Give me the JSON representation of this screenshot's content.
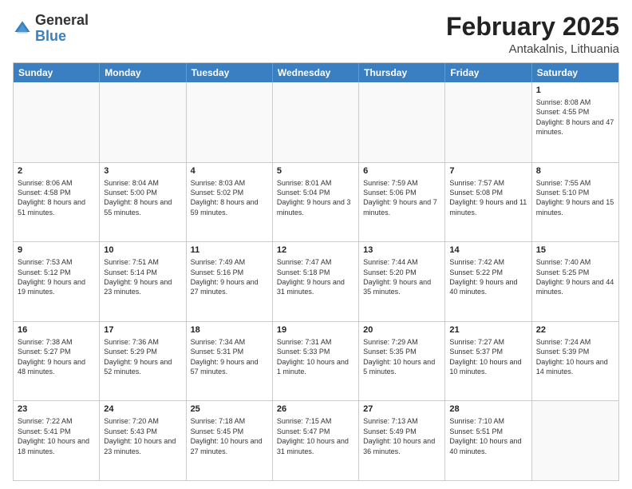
{
  "header": {
    "logo": {
      "general": "General",
      "blue": "Blue"
    },
    "title": "February 2025",
    "location": "Antakalnis, Lithuania"
  },
  "days_of_week": [
    "Sunday",
    "Monday",
    "Tuesday",
    "Wednesday",
    "Thursday",
    "Friday",
    "Saturday"
  ],
  "weeks": [
    [
      {
        "day": "",
        "text": ""
      },
      {
        "day": "",
        "text": ""
      },
      {
        "day": "",
        "text": ""
      },
      {
        "day": "",
        "text": ""
      },
      {
        "day": "",
        "text": ""
      },
      {
        "day": "",
        "text": ""
      },
      {
        "day": "1",
        "text": "Sunrise: 8:08 AM\nSunset: 4:55 PM\nDaylight: 8 hours and 47 minutes."
      }
    ],
    [
      {
        "day": "2",
        "text": "Sunrise: 8:06 AM\nSunset: 4:58 PM\nDaylight: 8 hours and 51 minutes."
      },
      {
        "day": "3",
        "text": "Sunrise: 8:04 AM\nSunset: 5:00 PM\nDaylight: 8 hours and 55 minutes."
      },
      {
        "day": "4",
        "text": "Sunrise: 8:03 AM\nSunset: 5:02 PM\nDaylight: 8 hours and 59 minutes."
      },
      {
        "day": "5",
        "text": "Sunrise: 8:01 AM\nSunset: 5:04 PM\nDaylight: 9 hours and 3 minutes."
      },
      {
        "day": "6",
        "text": "Sunrise: 7:59 AM\nSunset: 5:06 PM\nDaylight: 9 hours and 7 minutes."
      },
      {
        "day": "7",
        "text": "Sunrise: 7:57 AM\nSunset: 5:08 PM\nDaylight: 9 hours and 11 minutes."
      },
      {
        "day": "8",
        "text": "Sunrise: 7:55 AM\nSunset: 5:10 PM\nDaylight: 9 hours and 15 minutes."
      }
    ],
    [
      {
        "day": "9",
        "text": "Sunrise: 7:53 AM\nSunset: 5:12 PM\nDaylight: 9 hours and 19 minutes."
      },
      {
        "day": "10",
        "text": "Sunrise: 7:51 AM\nSunset: 5:14 PM\nDaylight: 9 hours and 23 minutes."
      },
      {
        "day": "11",
        "text": "Sunrise: 7:49 AM\nSunset: 5:16 PM\nDaylight: 9 hours and 27 minutes."
      },
      {
        "day": "12",
        "text": "Sunrise: 7:47 AM\nSunset: 5:18 PM\nDaylight: 9 hours and 31 minutes."
      },
      {
        "day": "13",
        "text": "Sunrise: 7:44 AM\nSunset: 5:20 PM\nDaylight: 9 hours and 35 minutes."
      },
      {
        "day": "14",
        "text": "Sunrise: 7:42 AM\nSunset: 5:22 PM\nDaylight: 9 hours and 40 minutes."
      },
      {
        "day": "15",
        "text": "Sunrise: 7:40 AM\nSunset: 5:25 PM\nDaylight: 9 hours and 44 minutes."
      }
    ],
    [
      {
        "day": "16",
        "text": "Sunrise: 7:38 AM\nSunset: 5:27 PM\nDaylight: 9 hours and 48 minutes."
      },
      {
        "day": "17",
        "text": "Sunrise: 7:36 AM\nSunset: 5:29 PM\nDaylight: 9 hours and 52 minutes."
      },
      {
        "day": "18",
        "text": "Sunrise: 7:34 AM\nSunset: 5:31 PM\nDaylight: 9 hours and 57 minutes."
      },
      {
        "day": "19",
        "text": "Sunrise: 7:31 AM\nSunset: 5:33 PM\nDaylight: 10 hours and 1 minute."
      },
      {
        "day": "20",
        "text": "Sunrise: 7:29 AM\nSunset: 5:35 PM\nDaylight: 10 hours and 5 minutes."
      },
      {
        "day": "21",
        "text": "Sunrise: 7:27 AM\nSunset: 5:37 PM\nDaylight: 10 hours and 10 minutes."
      },
      {
        "day": "22",
        "text": "Sunrise: 7:24 AM\nSunset: 5:39 PM\nDaylight: 10 hours and 14 minutes."
      }
    ],
    [
      {
        "day": "23",
        "text": "Sunrise: 7:22 AM\nSunset: 5:41 PM\nDaylight: 10 hours and 18 minutes."
      },
      {
        "day": "24",
        "text": "Sunrise: 7:20 AM\nSunset: 5:43 PM\nDaylight: 10 hours and 23 minutes."
      },
      {
        "day": "25",
        "text": "Sunrise: 7:18 AM\nSunset: 5:45 PM\nDaylight: 10 hours and 27 minutes."
      },
      {
        "day": "26",
        "text": "Sunrise: 7:15 AM\nSunset: 5:47 PM\nDaylight: 10 hours and 31 minutes."
      },
      {
        "day": "27",
        "text": "Sunrise: 7:13 AM\nSunset: 5:49 PM\nDaylight: 10 hours and 36 minutes."
      },
      {
        "day": "28",
        "text": "Sunrise: 7:10 AM\nSunset: 5:51 PM\nDaylight: 10 hours and 40 minutes."
      },
      {
        "day": "",
        "text": ""
      }
    ]
  ]
}
